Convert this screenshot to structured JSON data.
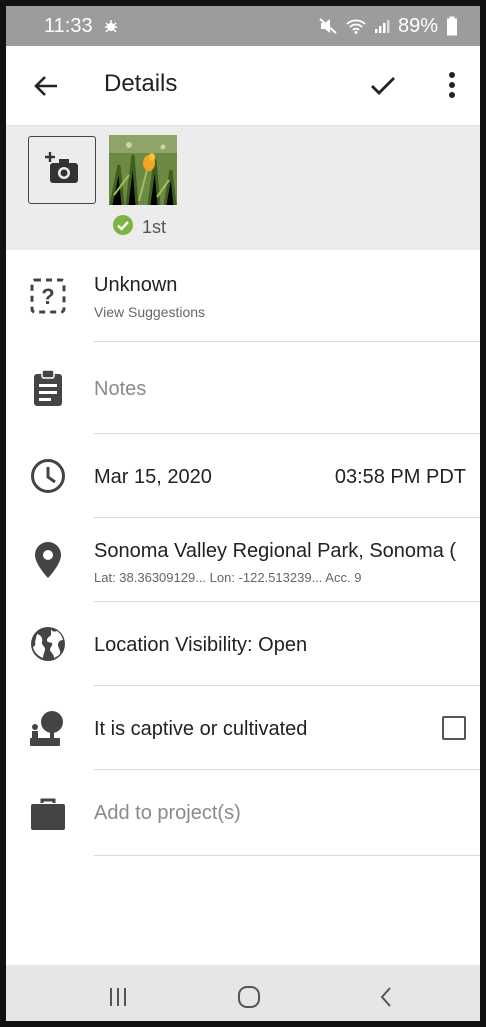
{
  "status_bar": {
    "time": "11:33",
    "battery": "89%",
    "icons": [
      "bug-icon",
      "mute-icon",
      "wifi-icon",
      "signal-icon",
      "battery-icon"
    ]
  },
  "app_bar": {
    "title": "Details",
    "icons": [
      "back-arrow-icon",
      "check-icon",
      "more-vert-icon"
    ]
  },
  "photos": {
    "first_label": "1st"
  },
  "identification": {
    "title": "Unknown",
    "subtitle": "View Suggestions"
  },
  "notes": {
    "placeholder": "Notes"
  },
  "datetime": {
    "date": "Mar 15, 2020",
    "time": "03:58 PM PDT"
  },
  "location": {
    "name": "Sonoma Valley Regional Park, Sonoma (",
    "details": "Lat: 38.36309129...  Lon: -122.513239...  Acc. 9"
  },
  "visibility": {
    "label": "Location Visibility: Open"
  },
  "captive": {
    "label": "It is captive or cultivated",
    "checked": false
  },
  "project": {
    "placeholder": "Add to project(s)"
  },
  "colors": {
    "status_bar": "#9c9c9c",
    "accent_green": "#7cb342",
    "icon_dark": "#444444"
  }
}
